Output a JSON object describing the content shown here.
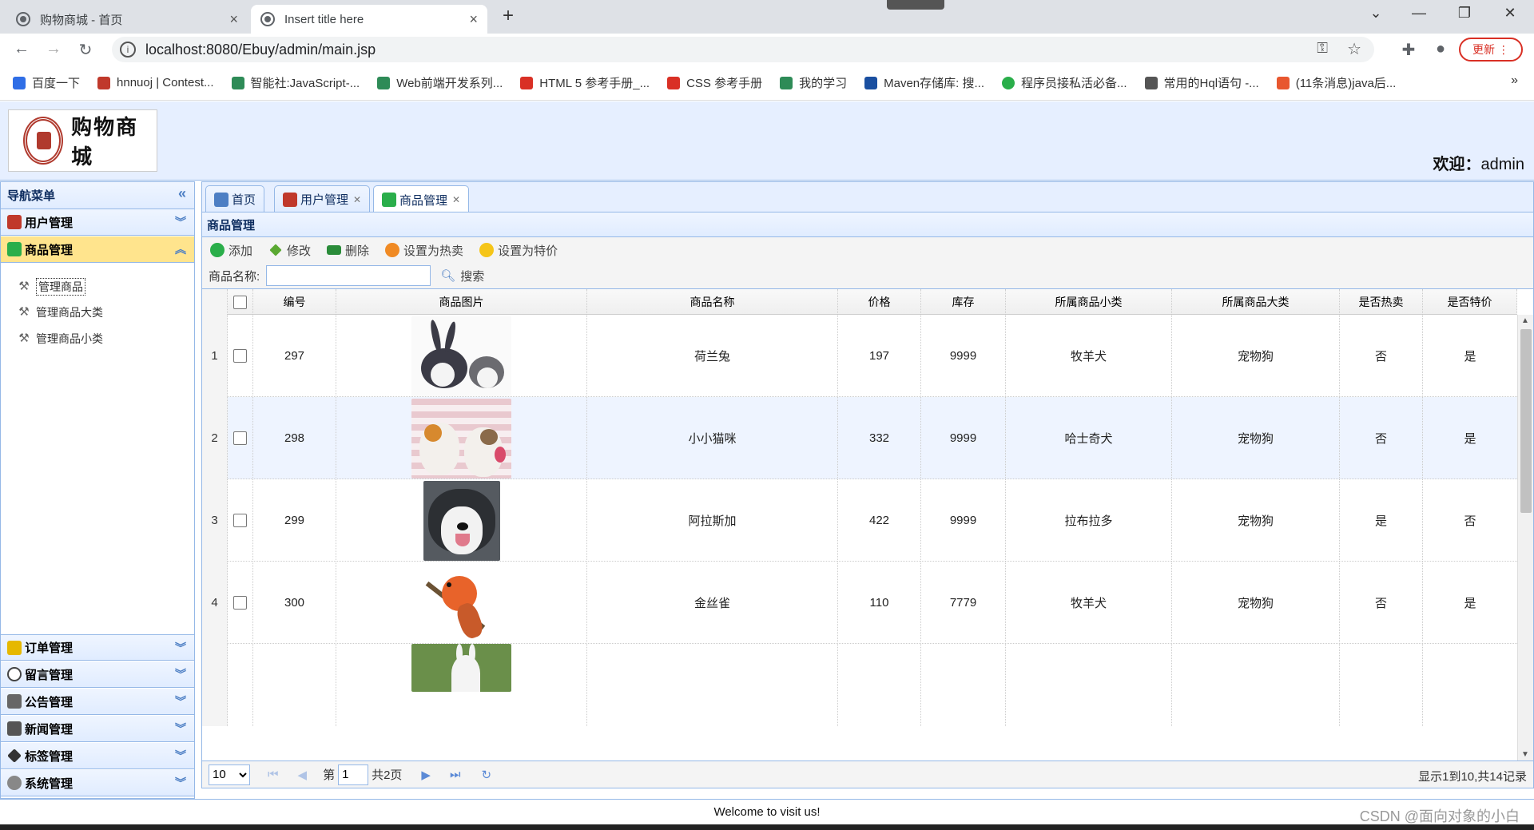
{
  "browser": {
    "tabs": [
      {
        "title": "购物商城 - 首页",
        "active": false
      },
      {
        "title": "Insert title here",
        "active": true
      }
    ],
    "new_tab": "+",
    "url": "localhost:8080/Ebuy/admin/main.jsp",
    "update_label": "更新",
    "bookmarks": [
      {
        "label": "百度一下",
        "color": "#2f6ee6"
      },
      {
        "label": "hnnuoj | Contest...",
        "color": "#c0392b"
      },
      {
        "label": "智能社:JavaScript-...",
        "color": "#2e8b57"
      },
      {
        "label": "Web前端开发系列...",
        "color": "#2e8b57"
      },
      {
        "label": "HTML 5 参考手册_...",
        "color": "#d93025"
      },
      {
        "label": "CSS 参考手册",
        "color": "#d93025"
      },
      {
        "label": "我的学习",
        "color": "#2e8b57"
      },
      {
        "label": "Maven存储库: 搜...",
        "color": "#1a4fa0"
      },
      {
        "label": "程序员接私活必备...",
        "color": "#2aae4a"
      },
      {
        "label": "常用的Hql语句 -...",
        "color": "#555555"
      },
      {
        "label": "(11条消息)java后...",
        "color": "#e8572f"
      }
    ],
    "more": "»"
  },
  "header": {
    "logo_text": "购物商城",
    "welcome_label": "欢迎：",
    "username": "admin"
  },
  "sidebar": {
    "title": "导航菜单",
    "collapse": "«",
    "menus": [
      {
        "label": "用户管理",
        "color": "#c0392b"
      },
      {
        "label": "商品管理",
        "color": "#2aae4a"
      },
      {
        "label": "订单管理",
        "color": "#e6b800"
      },
      {
        "label": "留言管理",
        "color": "#444444"
      },
      {
        "label": "公告管理",
        "color": "#666666"
      },
      {
        "label": "新闻管理",
        "color": "#555555"
      },
      {
        "label": "标签管理",
        "color": "#333333"
      },
      {
        "label": "系统管理",
        "color": "#888888"
      }
    ],
    "sub_items": [
      "管理商品",
      "管理商品大类",
      "管理商品小类"
    ]
  },
  "tabs": [
    {
      "label": "首页",
      "closable": false
    },
    {
      "label": "用户管理",
      "closable": true
    },
    {
      "label": "商品管理",
      "closable": true
    }
  ],
  "panel_title": "商品管理",
  "toolbar": {
    "add": "添加",
    "edit": "修改",
    "delete": "删除",
    "hot": "设置为热卖",
    "special": "设置为特价"
  },
  "search": {
    "label": "商品名称:",
    "value": "",
    "button": "搜索"
  },
  "grid": {
    "columns": [
      "编号",
      "商品图片",
      "商品名称",
      "价格",
      "库存",
      "所属商品小类",
      "所属商品大类",
      "是否热卖",
      "是否特价"
    ],
    "rows": [
      {
        "n": "1",
        "id": "297",
        "name": "荷兰兔",
        "price": "197",
        "stock": "9999",
        "sub": "牧羊犬",
        "cat": "宠物狗",
        "hot": "否",
        "special": "是"
      },
      {
        "n": "2",
        "id": "298",
        "name": "小小猫咪",
        "price": "332",
        "stock": "9999",
        "sub": "哈士奇犬",
        "cat": "宠物狗",
        "hot": "否",
        "special": "是"
      },
      {
        "n": "3",
        "id": "299",
        "name": "阿拉斯加",
        "price": "422",
        "stock": "9999",
        "sub": "拉布拉多",
        "cat": "宠物狗",
        "hot": "是",
        "special": "否"
      },
      {
        "n": "4",
        "id": "300",
        "name": "金丝雀",
        "price": "110",
        "stock": "7779",
        "sub": "牧羊犬",
        "cat": "宠物狗",
        "hot": "否",
        "special": "是"
      }
    ]
  },
  "pager": {
    "page_size": "10",
    "page_label": "第",
    "page": "1",
    "total_pages": "共2页",
    "info": "显示1到10,共14记录"
  },
  "footer": "Welcome to visit us!",
  "watermark": "CSDN @面向对象的小白"
}
